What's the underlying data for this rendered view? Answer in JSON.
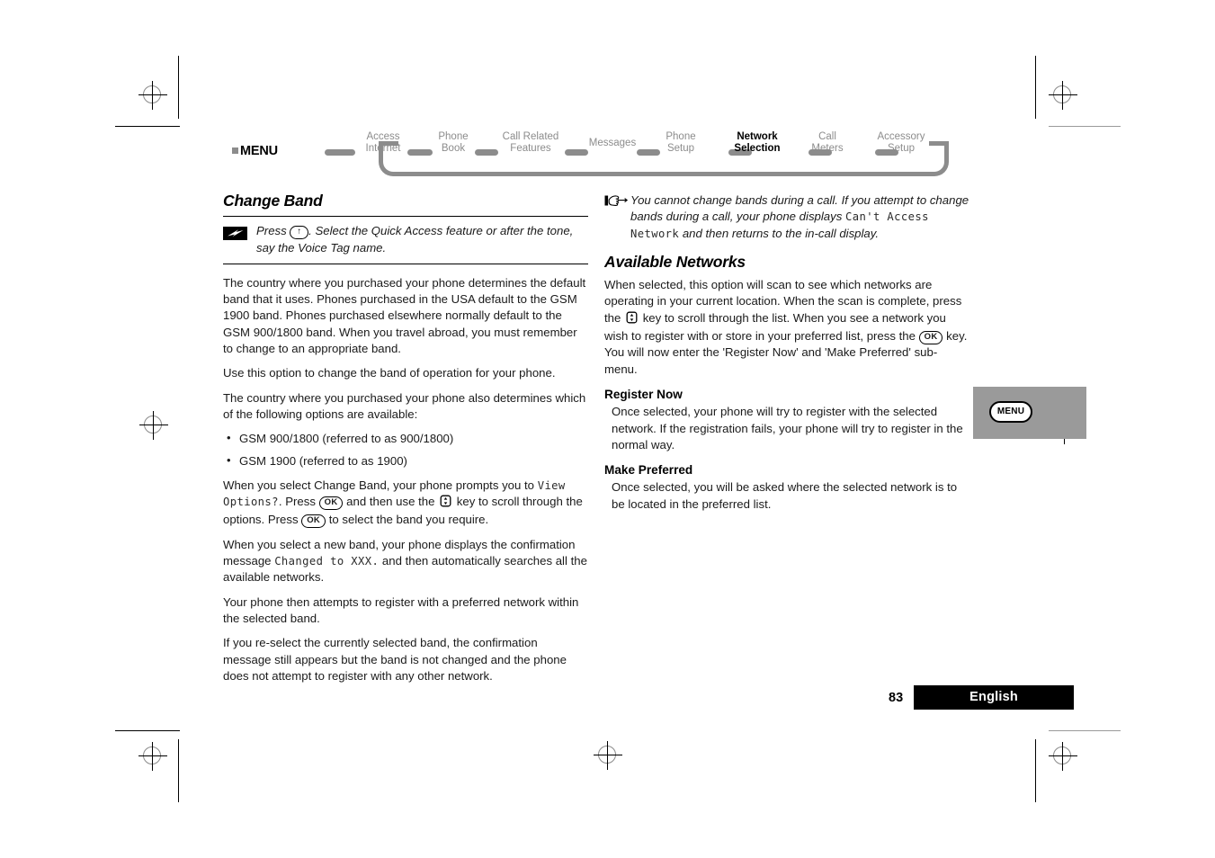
{
  "breadcrumb": {
    "menu_label": "MENU",
    "items": [
      {
        "line1": "Access",
        "line2": "Internet"
      },
      {
        "line1": "Phone",
        "line2": "Book"
      },
      {
        "line1": "Call Related",
        "line2": "Features"
      },
      {
        "line1": "Messages",
        "line2": ""
      },
      {
        "line1": "Phone",
        "line2": "Setup"
      },
      {
        "line1": "Network",
        "line2": "Selection"
      },
      {
        "line1": "Call",
        "line2": "Meters"
      },
      {
        "line1": "Accessory",
        "line2": "Setup"
      }
    ],
    "current": "Network Selection"
  },
  "left_column": {
    "heading": "Change Band",
    "shortcut": {
      "icon": "lightning-bolt-icon",
      "text_before_key": "Press",
      "key_label": "↑",
      "text_after_key": ". Select the Quick Access feature or after the tone, say the Voice Tag name."
    },
    "paragraphs": {
      "p1": "The country where you purchased your phone determines the default band that it uses. Phones purchased in the USA default to the GSM 1900 band. Phones purchased elsewhere normally default to the GSM 900/1800 band. When you travel abroad, you must remember to change to an appropriate band.",
      "p2": "Use this option to change the band of operation for your phone.",
      "p3": "The country where you purchased your phone also determines which of the following options are available:",
      "p5_a": "When you select Change Band, your phone prompts you to",
      "p5_lcd": "View Options?",
      "p5_b": ". Press",
      "p5_ok1": "OK",
      "p5_c": "and then use the",
      "p5_d": "key to scroll through the options. Press",
      "p5_ok2": "OK",
      "p5_e": "to select the band you require.",
      "p6_a": "When you select a new band, your phone displays the confirmation message",
      "p6_lcd": "Changed to XXX.",
      "p6_b": "and then automatically searches all the available networks.",
      "p7": "Your phone then attempts to register with a preferred network within the selected band.",
      "p8": "If you re-select the currently selected band, the confirmation message still appears but the band is not changed and the phone does not attempt to register with any other network."
    },
    "bullets": [
      "GSM 900/1800 (referred to as 900/1800)",
      "GSM 1900 (referred to as 1900)"
    ]
  },
  "right_column": {
    "hint": {
      "icon": "pointing-hand-icon",
      "text_a": "You cannot change bands during a call. If you attempt to change bands during a call, your phone displays",
      "lcd": "Can't Access Network",
      "text_b": "and then returns to the in-call display."
    },
    "heading": "Available Networks",
    "intro": {
      "text_a": "When selected, this option will scan to see which networks are operating in your current location. When the scan is complete, press the",
      "text_b": "key to scroll through the list. When you see a network you wish to register with or store in your preferred list, press the",
      "ok_label": "OK",
      "text_c": "key. You will now enter the 'Register Now' and 'Make Preferred' sub-menu."
    },
    "subsections": [
      {
        "heading": "Register Now",
        "body": "Once selected, your phone will try to register with the selected network. If the registration fails, your phone will try to register in the normal way."
      },
      {
        "heading": "Make Preferred",
        "body": "Once selected, you will be asked where the selected network is to be located in the preferred list."
      }
    ]
  },
  "callout": {
    "button_label": "MENU"
  },
  "footer": {
    "page_number": "83",
    "language": "English"
  },
  "colors": {
    "breadcrumb_gray": "#8c8c8c",
    "callout_gray": "#9a9a9a",
    "footer_bar": "#000000"
  }
}
